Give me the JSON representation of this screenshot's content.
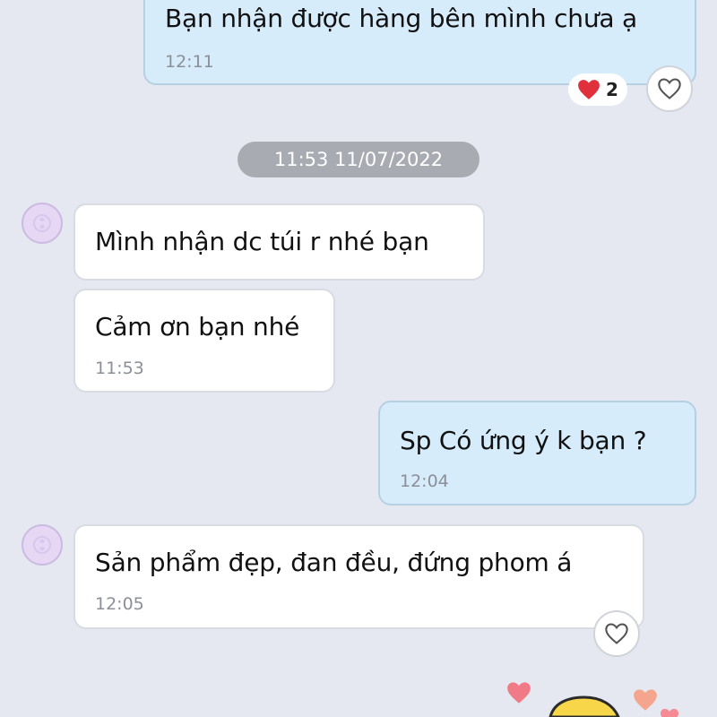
{
  "messages": [
    {
      "direction": "out",
      "text": "Bạn nhận được hàng bên mình chưa ạ",
      "time": "12:11"
    },
    {
      "direction": "in",
      "text": "Mình nhận dc túi r nhé bạn"
    },
    {
      "direction": "in",
      "text": "Cảm ơn bạn nhé",
      "time": "11:53"
    },
    {
      "direction": "out",
      "text": "Sp Có ứng ý k bạn ?",
      "time": "12:04"
    },
    {
      "direction": "in",
      "text": "Sản phẩm đẹp, đan đều, đứng phom á",
      "time": "12:05"
    }
  ],
  "date_separator": "11:53 11/07/2022",
  "reaction": {
    "icon": "red-heart-icon",
    "count": "2"
  },
  "colors": {
    "background": "#e5e8f0",
    "incoming_bubble": "#ffffff",
    "outgoing_bubble": "#d7ecfb",
    "date_pill": "#a8abb2",
    "time_text": "#8b8f97"
  }
}
